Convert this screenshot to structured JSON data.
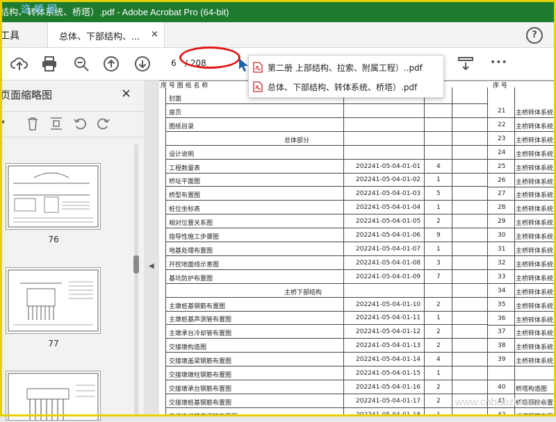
{
  "window": {
    "title": "结构、转体系统、桥塔）.pdf - Adobe Acrobat Pro (64-bit)",
    "watermark_top": "这 桥 网"
  },
  "menu": {
    "tools_label": "工具",
    "doc_tab_label": "总体、下部结构、...",
    "close_tab_symbol": "×",
    "help_symbol": "?"
  },
  "toolbar": {
    "page_current": "6",
    "page_total": "/ 208",
    "more_symbol": "•••",
    "icons": [
      "upload-cloud-icon",
      "print-icon",
      "zoom-out-icon",
      "page-up-icon",
      "page-down-icon",
      "pointer-icon",
      "scroll-mode-icon",
      "more-icon"
    ]
  },
  "flyout": {
    "items": [
      {
        "label": "第二册 上部结构、拉索、附属工程）..pdf"
      },
      {
        "label": "总体、下部结构、转体系统、桥塔）.pdf"
      }
    ]
  },
  "left_panel": {
    "title": "页面缩略图",
    "close_symbol": "×",
    "thumbnails": [
      {
        "page": "76"
      },
      {
        "page": "77"
      }
    ]
  },
  "document": {
    "header_left": "序  号    图  纸  名  称",
    "header_right": "序  号",
    "rows": [
      {
        "name": "封面",
        "code": "",
        "n": ""
      },
      {
        "name": "扉页",
        "code": "",
        "n": ""
      },
      {
        "name": "图纸目录",
        "code": "",
        "n": ""
      },
      {
        "section": "总体部分"
      },
      {
        "name": "设计说明",
        "code": "",
        "n": ""
      },
      {
        "name": "工程数量表",
        "code": "202241-05-04-01-01",
        "n": "4"
      },
      {
        "name": "桥址平面图",
        "code": "202241-05-04-01-02",
        "n": "1"
      },
      {
        "name": "桥型布置图",
        "code": "202241-05-04-01-03",
        "n": "5"
      },
      {
        "name": "桩位坐标表",
        "code": "202241-05-04-01-04",
        "n": "1"
      },
      {
        "name": "相对位置关系图",
        "code": "202241-05-04-01-05",
        "n": "2"
      },
      {
        "name": "指导性施工步骤图",
        "code": "202241-05-04-01-06",
        "n": "9"
      },
      {
        "name": "地基处理布置图",
        "code": "202241-05-04-01-07",
        "n": "1"
      },
      {
        "name": "开挖地面线示意图",
        "code": "202241-05-04-01-08",
        "n": "3"
      },
      {
        "name": "基坑防护布置图",
        "code": "202241-05-04-01-09",
        "n": "7"
      },
      {
        "section": "主桥下部结构"
      },
      {
        "name": "主墩桩基钢筋布置图",
        "code": "202241-05-04-01-10",
        "n": "2"
      },
      {
        "name": "主墩桩基声测管布置图",
        "code": "202241-05-04-01-11",
        "n": "1"
      },
      {
        "name": "主墩承台冷却管布置图",
        "code": "202241-05-04-01-12",
        "n": "2"
      },
      {
        "name": "交接墩构造图",
        "code": "202241-05-04-01-13",
        "n": "2"
      },
      {
        "name": "交接墩盖梁钢筋布置图",
        "code": "202241-05-04-01-14",
        "n": "4"
      },
      {
        "name": "交接墩墩柱钢筋布置图",
        "code": "202241-05-04-01-15",
        "n": "1"
      },
      {
        "name": "交接墩承台钢筋布置图",
        "code": "202241-05-04-01-16",
        "n": "2"
      },
      {
        "name": "交接墩桩基钢筋布置图",
        "code": "202241-05-04-01-17",
        "n": "2"
      },
      {
        "name": "交接墩桩基声测管布置图",
        "code": "202241-05-04-01-18",
        "n": "1"
      }
    ],
    "right_rows": [
      {
        "num": "21",
        "name": "主桥转体系统"
      },
      {
        "num": "22",
        "name": "主桥转体系统"
      },
      {
        "num": "23",
        "name": "主桥转体系统"
      },
      {
        "num": "24",
        "name": "主桥转体系统"
      },
      {
        "num": "25",
        "name": "主桥转体系统"
      },
      {
        "num": "26",
        "name": "主桥转体系统"
      },
      {
        "num": "27",
        "name": "主桥转体系统"
      },
      {
        "num": "28",
        "name": "主桥转体系统"
      },
      {
        "num": "29",
        "name": "主桥转体系统"
      },
      {
        "num": "30",
        "name": "主桥转体系统"
      },
      {
        "num": "31",
        "name": "主桥转体系统"
      },
      {
        "num": "32",
        "name": "主桥转体系统"
      },
      {
        "num": "33",
        "name": "主桥转体系统"
      },
      {
        "num": "34",
        "name": "主桥转体系统"
      },
      {
        "num": "35",
        "name": "主桥转体系统"
      },
      {
        "num": "36",
        "name": "主桥转体系统"
      },
      {
        "num": "37",
        "name": "主桥转体系统"
      },
      {
        "num": "38",
        "name": "主桥转体系统"
      },
      {
        "num": "39",
        "name": "主桥转体系统"
      },
      {
        "num": "",
        "name": ""
      },
      {
        "num": "40",
        "name": "桥塔构造图"
      },
      {
        "num": "41",
        "name": "桥塔钢筋布置"
      },
      {
        "num": "42",
        "name": "桥塔钢筋布置"
      }
    ]
  },
  "watermark": "www.cnbaozhi.com"
}
